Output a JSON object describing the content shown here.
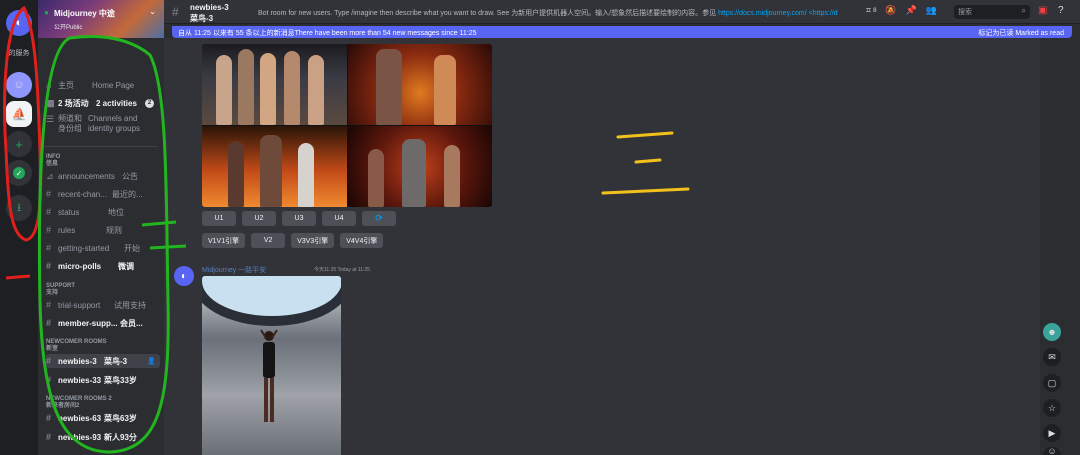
{
  "rail": {
    "label": "的服务",
    "items": [
      "home",
      "midjourney-avatar",
      "sailboat-server",
      "add-server",
      "explore",
      "download"
    ]
  },
  "server": {
    "name": "Midjourney 中途",
    "sub": "公开Public"
  },
  "nav": {
    "home_cn": "主页",
    "home_en": "Home Page",
    "activities": "2 场活动",
    "activities_en": "2 activities",
    "activities_badge": "2",
    "channels_cn": "频道和",
    "channels_cn2": "身份组",
    "channels_en": "Channels and",
    "channels_en2": "identity groups"
  },
  "categories": {
    "info": "INFO",
    "info_cn": "信息",
    "support": "SUPPORT",
    "support_cn": "支持",
    "newcomer": "NEWCOMER ROOMS",
    "newcomer_cn": "新室",
    "newcomer2": "NEWCOMER ROOMS 2",
    "newcomer2_cn": "新来者房间2"
  },
  "channels": [
    {
      "name": "announcements",
      "cn": "公告"
    },
    {
      "name": "recent-chan...",
      "cn": "最近的..."
    },
    {
      "name": "status",
      "cn": "地位"
    },
    {
      "name": "rules",
      "cn": "规则"
    },
    {
      "name": "getting-started",
      "cn": "开始"
    },
    {
      "name": "micro-polls",
      "cn": "微调"
    },
    {
      "name": "trial-support",
      "cn": "试用支持"
    },
    {
      "name": "member-supp...",
      "cn": "会员..."
    },
    {
      "name": "newbies-3",
      "cn": "菜鸟-3"
    },
    {
      "name": "newbies-33",
      "cn": "菜鸟33岁"
    },
    {
      "name": "newbies-63",
      "cn": "菜鸟63岁"
    },
    {
      "name": "newbies-93",
      "cn": "新人93分"
    }
  ],
  "topbar": {
    "channel": "newbies-3",
    "channel_cn": "菜鸟-3",
    "topic": "Bot room for new users. Type /imagine then describe what you want to draw. See",
    "topic_cn": "为新用户提供机器人空间。输入/想象然后描述要绘制的内容。参见",
    "topic_link": "https://docs.midjourney.com/",
    "topic_link2": "<https://d",
    "threads_count": "8",
    "search_placeholder": "搜索"
  },
  "banner": {
    "text": "自从 11:25 以来有 55 条以上的新消息There have been more than 54 new messages since 11:25",
    "mark": "标记为已读   Marked as read"
  },
  "buttons_row1": [
    "U1",
    "U2",
    "U3",
    "U4",
    "⟳"
  ],
  "buttons_row2": [
    "V1V1引擎",
    "V2",
    "V3V3引擎",
    "V4V4引擎"
  ],
  "message": {
    "author": "Midjourney 一路平安",
    "time": "今天11:25 Today at 11:25"
  },
  "side_icons": [
    "robot-icon",
    "chat-icon",
    "box-icon",
    "star-icon",
    "video-icon",
    "sticker-icon"
  ],
  "colors": {
    "accent": "#5865f2",
    "annotation_red": "#e0201c",
    "annotation_green": "#23b51f",
    "annotation_yellow": "#f2c21b"
  }
}
